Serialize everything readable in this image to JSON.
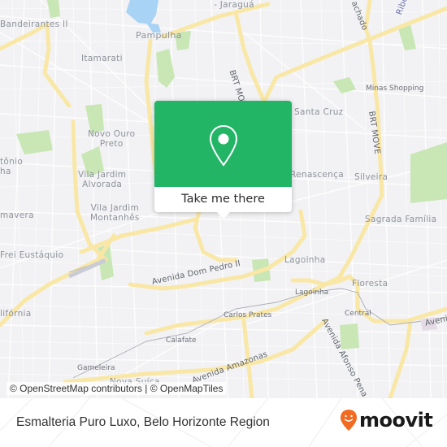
{
  "map": {
    "neighborhoods": [
      {
        "id": "bandeirantes",
        "text": "Bandeirantes II"
      },
      {
        "id": "jaragua",
        "text": "- Jaraguá"
      },
      {
        "id": "pampulha",
        "text": "Pampulha"
      },
      {
        "id": "itamarati",
        "text": "Itamarati"
      },
      {
        "id": "novo-ouro-preto",
        "text": "Novo Ouro\nPreto"
      },
      {
        "id": "antonio",
        "text": "tônio\nha"
      },
      {
        "id": "vila-jardim-alvorada",
        "text": "Vila Jardim\nAlvorada"
      },
      {
        "id": "vila-jardim-montanhes",
        "text": "Vila Jardim\nMontanhês"
      },
      {
        "id": "primavera",
        "text": "mavera"
      },
      {
        "id": "frei-eustaquio",
        "text": "Frei Eustáquio"
      },
      {
        "id": "california",
        "text": "lifórnia"
      },
      {
        "id": "santa-cruz",
        "text": "Santa Cruz"
      },
      {
        "id": "renascenca",
        "text": "Renascença"
      },
      {
        "id": "silveira",
        "text": "Silveira"
      },
      {
        "id": "sagrada-familia",
        "text": "Sagrada Família"
      },
      {
        "id": "lagoinha",
        "text": "Lagoinha"
      },
      {
        "id": "floresta",
        "text": "Floresta"
      },
      {
        "id": "nova-suica",
        "text": "Nova Suíça"
      }
    ],
    "stations": [
      {
        "id": "minas-shopping",
        "text": "Minas Shopping"
      },
      {
        "id": "lagoinha-station",
        "text": "Lagoinha"
      },
      {
        "id": "carlos-prates",
        "text": "Carlos Prates"
      },
      {
        "id": "central",
        "text": "Central"
      },
      {
        "id": "calafate",
        "text": "Calafate"
      },
      {
        "id": "gameleira",
        "text": "Gameleira"
      }
    ],
    "roads": [
      {
        "id": "brt-move-1",
        "text": "BRT MOVE"
      },
      {
        "id": "brt-move-2",
        "text": "BRT MOVE"
      },
      {
        "id": "machado",
        "text": "achado"
      },
      {
        "id": "ribeiro",
        "text": "Ribe"
      },
      {
        "id": "dom-pedro",
        "text": "Avenida Dom Pedro II"
      },
      {
        "id": "amazonas",
        "text": "Avenida Amazonas"
      },
      {
        "id": "afonso-pena",
        "text": "Avenida Afonso Pena"
      },
      {
        "id": "aven-east",
        "text": "Aveni"
      }
    ],
    "attribution": "© OpenStreetMap contributors | © OpenMapTiles"
  },
  "popup": {
    "icon": "map-pin-icon",
    "cta_label": "Take me there",
    "accent": "#22b566"
  },
  "footer": {
    "place_title": "Esmalteria Puro Luxo, Belo Horizonte Region",
    "brand": "moovit",
    "brand_color": "#f26b21"
  }
}
